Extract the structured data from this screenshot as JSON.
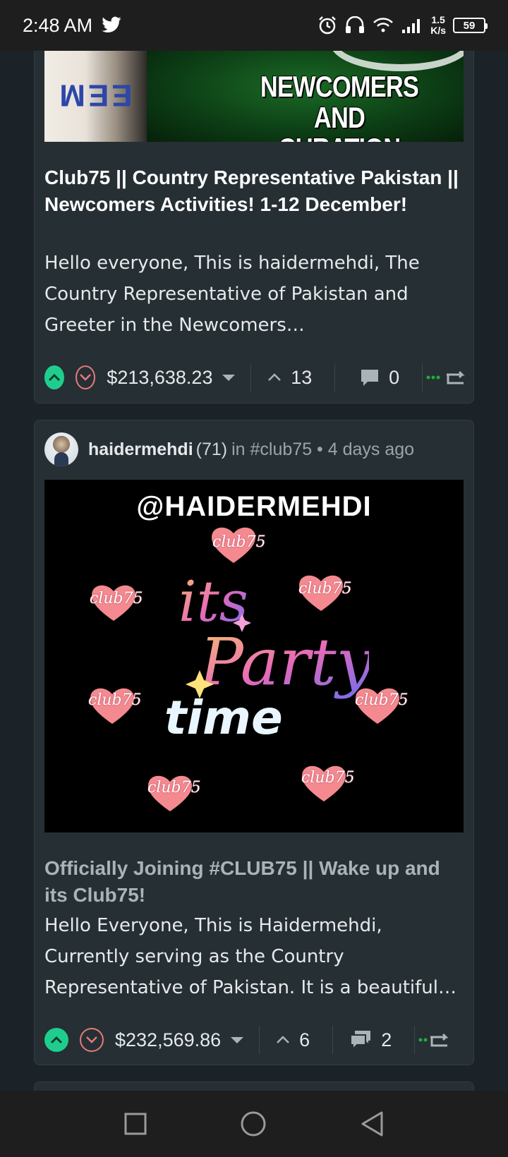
{
  "status_bar": {
    "time": "2:48 AM",
    "net_speed_value": "1.5",
    "net_speed_unit": "K/s",
    "battery": "59"
  },
  "posts": [
    {
      "banner_letters": "EEM",
      "banner_text_line1": "NEWCOMERS",
      "banner_text_line2": "AND CURATION",
      "title": "Club75 || Country Representative Pakistan || Newcomers Activities! 1-12 December!",
      "excerpt": "Hello everyone, This is haidermehdi, The Country Representative of Pakistan and Greeter in the Newcomers…",
      "payout": "$213,638.23",
      "votes": "13",
      "comments": "0"
    },
    {
      "author": "haidermehdi",
      "reputation": "(71)",
      "community": "in #club75 • 4 days ago",
      "image_handle": "@HAIDERMEHDI",
      "image_heart_label": "club75",
      "image_text_1": "its",
      "image_text_2": "Party",
      "image_text_3": "time",
      "title": "Officially Joining #CLUB75 || Wake up and its Club75!",
      "excerpt": "Hello Everyone, This is Haidermehdi, Currently serving as the Country Representative of Pakistan. It is a beautiful…",
      "payout": "$232,569.86",
      "votes": "6",
      "comments": "2"
    }
  ],
  "colors": {
    "background": "#1b2329",
    "card": "#262f34",
    "upvote": "#1fce8f",
    "downvote": "#e57a7a"
  }
}
